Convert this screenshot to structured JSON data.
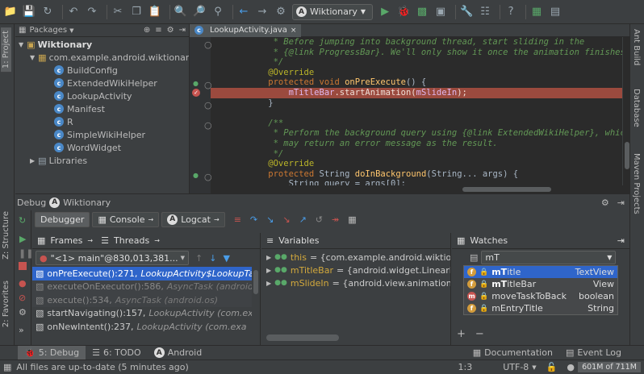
{
  "toolbar": {
    "run_config": "Wiktionary"
  },
  "left_strip": {
    "project_tab": "1: Project",
    "structure_tab": "Z: Structure",
    "favorites_tab": "2: Favorites"
  },
  "right_strip": {
    "ant_build": "Ant Build",
    "database": "Database",
    "maven": "Maven Projects"
  },
  "project": {
    "view_mode": "Packages",
    "root": "Wiktionary",
    "package": "com.example.android.wiktionary",
    "classes": [
      "BuildConfig",
      "ExtendedWikiHelper",
      "LookupActivity",
      "Manifest",
      "R",
      "SimpleWikiHelper",
      "WordWidget"
    ],
    "libraries": "Libraries"
  },
  "editor": {
    "tab_label": "LookupActivity.java",
    "lines": [
      [
        [
          "cm",
          "     * Before jumping into background thread, start sliding in the"
        ]
      ],
      [
        [
          "cm",
          "     * {@link ProgressBar}. We'll only show it once the animation finishes."
        ]
      ],
      [
        [
          "cm",
          "     */"
        ]
      ],
      [
        [
          "ann",
          "    @Override"
        ]
      ],
      [
        [
          "kw",
          "    protected void "
        ],
        [
          "fn",
          "onPreExecute"
        ],
        [
          "plain",
          "() {"
        ]
      ],
      [
        [
          "fld",
          "        mTitleBar"
        ],
        [
          "plain",
          ".startAnimation("
        ],
        [
          "fld",
          "mSlideIn"
        ],
        [
          "plain",
          ");"
        ]
      ],
      [
        [
          "plain",
          "    }"
        ]
      ],
      [
        [
          "plain",
          ""
        ]
      ],
      [
        [
          "cm",
          "    /**"
        ]
      ],
      [
        [
          "cm",
          "     * Perform the background query using {@link ExtendedWikiHelper}, which"
        ]
      ],
      [
        [
          "cm",
          "     * may return an error message as the result."
        ]
      ],
      [
        [
          "cm",
          "     */"
        ]
      ],
      [
        [
          "ann",
          "    @Override"
        ]
      ],
      [
        [
          "kw",
          "    protected "
        ],
        [
          "plain",
          "String "
        ],
        [
          "fn",
          "doInBackground"
        ],
        [
          "plain",
          "(String... args) {"
        ]
      ],
      [
        [
          "plain",
          "        String query = args[0];"
        ]
      ]
    ]
  },
  "debug": {
    "title_prefix": "Debug",
    "title": "Wiktionary",
    "tabs": [
      "Debugger",
      "Console",
      "Logcat"
    ],
    "frames_tab": "Frames",
    "threads_tab": "Threads",
    "thread_select": "\"<1> main\"@830,013,381...",
    "frames": [
      {
        "method": "onPreExecute():271,",
        "cls": "LookupActivity$LookupTa",
        "style": "selected"
      },
      {
        "method": "executeOnExecutor():586,",
        "cls": "AsyncTask (android.o",
        "style": "dim"
      },
      {
        "method": "execute():534,",
        "cls": "AsyncTask (android.os)",
        "style": "dim"
      },
      {
        "method": "startNavigating():157,",
        "cls": "LookupActivity (com.exa",
        "style": "normal"
      },
      {
        "method": "onNewIntent():237,",
        "cls": "LookupActivity (com.exa",
        "style": "normal"
      }
    ],
    "variables_title": "Variables",
    "variables": [
      {
        "name": "this",
        "value": "= {com.example.android.wiktiona"
      },
      {
        "name": "mTitleBar",
        "value": "= {android.widget.LinearLayo"
      },
      {
        "name": "mSlideIn",
        "value": "= {android.view.animation.Ani"
      }
    ],
    "watches_title": "Watches",
    "watch_input": "mT",
    "completions": [
      {
        "match": "mT",
        "rest": "itle",
        "type": "TextView",
        "icon": "f"
      },
      {
        "match": "mT",
        "rest": "itleBar",
        "type": "View",
        "icon": "f"
      },
      {
        "match": "",
        "rest": "moveTaskToBack",
        "type": "boolean",
        "icon": "m"
      },
      {
        "match": "",
        "rest": "mEntryTitle",
        "type": "String",
        "icon": "f"
      }
    ]
  },
  "bottom_tabs": [
    "5: Debug",
    "6: TODO",
    "Android",
    "Documentation",
    "Event Log"
  ],
  "status": {
    "message": "All files are up-to-date (5 minutes ago)",
    "position": "1:3",
    "encoding": "UTF-8",
    "memory": "601M of 711M"
  },
  "colors": {
    "breakpoint_line": "#9b4a3e",
    "selected_frame": "#2f65ca",
    "completion_selected": "#2f65ca"
  }
}
